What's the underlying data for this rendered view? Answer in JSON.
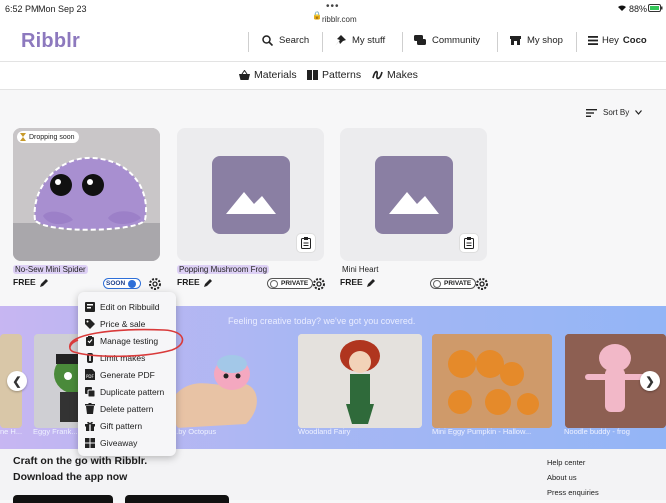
{
  "status_bar": {
    "time": "6:52 PM",
    "date": "Mon Sep 23",
    "url": "ribblr.com",
    "battery": "88%"
  },
  "header": {
    "logo": "Ribblr",
    "nav": [
      {
        "label": "Search",
        "icon": "search-icon"
      },
      {
        "label": "My stuff",
        "icon": "pin-icon"
      },
      {
        "label": "Community",
        "icon": "chat-icon"
      },
      {
        "label": "My shop",
        "icon": "shop-icon"
      },
      {
        "label_prefix": "Hey",
        "label_name": "Coco",
        "icon": "hamburger-icon"
      }
    ]
  },
  "subnav": [
    {
      "label": "Materials",
      "icon": "basket-icon"
    },
    {
      "label": "Patterns",
      "icon": "book-icon"
    },
    {
      "label": "Makes",
      "icon": "yarn-icon"
    }
  ],
  "sort": {
    "label": "Sort By"
  },
  "cards": [
    {
      "title": "No-Sew Mini Spider",
      "price": "FREE",
      "badge": "Dropping soon",
      "toggle": "SOON",
      "thumbnail": "photo"
    },
    {
      "title": "Popping Mushroom Frog",
      "price": "FREE",
      "toggle": "PRIVATE",
      "thumbnail": "placeholder"
    },
    {
      "title": "Mini Heart",
      "price": "FREE",
      "toggle": "PRIVATE",
      "thumbnail": "placeholder"
    }
  ],
  "banner": {
    "text": "Feeling creative today? we've got you covered.",
    "items": [
      {
        "label": "ne H..."
      },
      {
        "label": "Eggy Frank..."
      },
      {
        "label": "...by Octopus"
      },
      {
        "label": "Woodland Fairy"
      },
      {
        "label": "Mini Eggy Pumpkin - Hallow..."
      },
      {
        "label": "Noodle buddy - frog"
      }
    ]
  },
  "context_menu": {
    "items": [
      {
        "label": "Edit on Ribbuild",
        "icon": "ribbuild-icon"
      },
      {
        "label": "Price & sale",
        "icon": "price-tag-icon"
      },
      {
        "label": "Manage testing",
        "icon": "testing-icon"
      },
      {
        "label": "Limit makes",
        "icon": "limit-icon"
      },
      {
        "label": "Generate PDF",
        "icon": "pdf-icon"
      },
      {
        "label": "Duplicate pattern",
        "icon": "duplicate-icon"
      },
      {
        "label": "Delete pattern",
        "icon": "trash-icon"
      },
      {
        "label": "Gift pattern",
        "icon": "gift-icon"
      },
      {
        "label": "Giveaway",
        "icon": "giveaway-icon"
      }
    ]
  },
  "footer": {
    "headline_1": "Craft on the go with Ribblr.",
    "headline_2": "Download the app now",
    "links": [
      "Help center",
      "About us",
      "Press enquiries"
    ]
  },
  "colors": {
    "brand": "#8d79be",
    "highlight": "#ddd0f5",
    "annotation": "#d93a3a"
  }
}
